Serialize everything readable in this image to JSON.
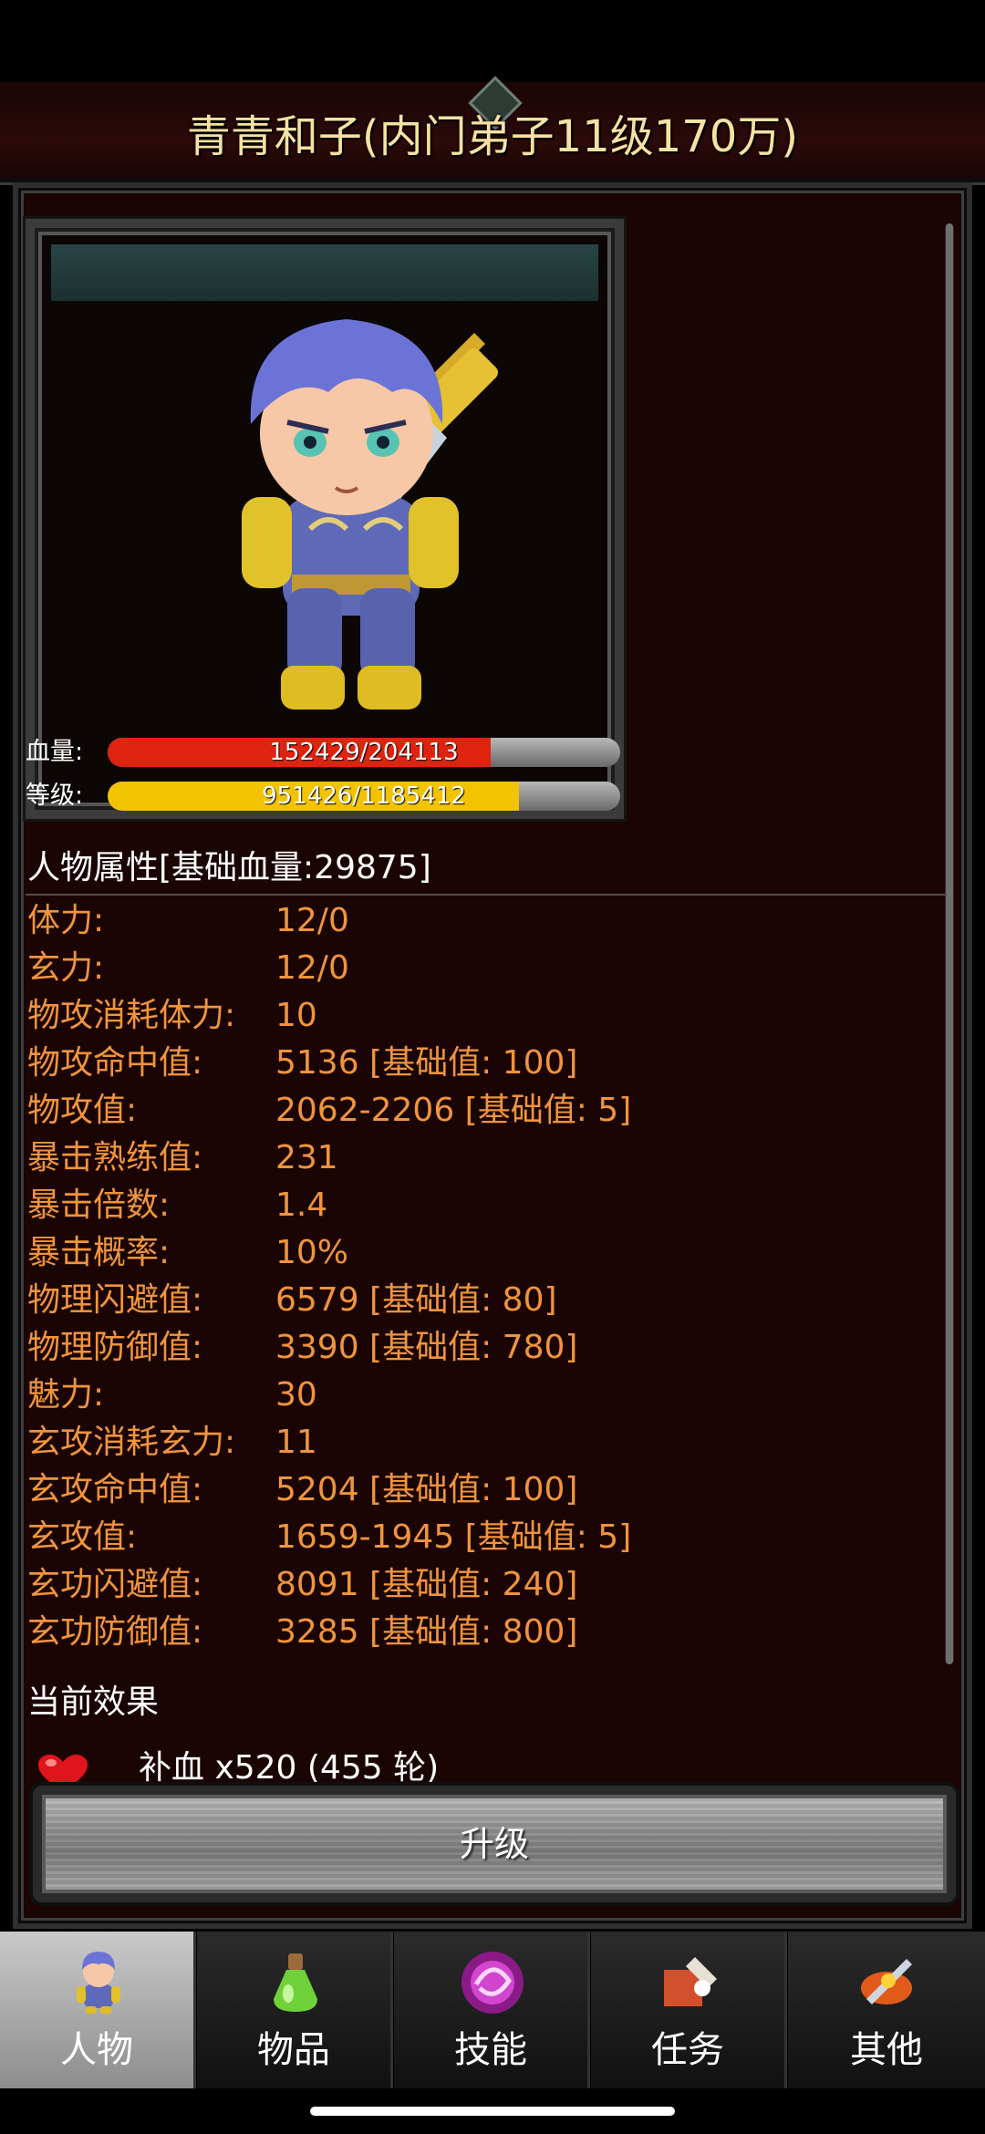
{
  "header": {
    "title": "青青和子(内门弟子11级170万)"
  },
  "character": {
    "hp": {
      "label": "血量:",
      "text": "152429/204113",
      "fraction": 0.7468
    },
    "level": {
      "label": "等级:",
      "text": "951426/1185412",
      "fraction": 0.8026
    }
  },
  "attributes": {
    "heading": "人物属性[基础血量:29875]",
    "rows": [
      {
        "name": "体力:",
        "value": "12/0"
      },
      {
        "name": "玄力:",
        "value": "12/0"
      },
      {
        "name": "物攻消耗体力:",
        "value": "10"
      },
      {
        "name": "物攻命中值:",
        "value": "5136 [基础值: 100]"
      },
      {
        "name": "物攻值:",
        "value": "2062-2206 [基础值: 5]"
      },
      {
        "name": "暴击熟练值:",
        "value": "231"
      },
      {
        "name": "暴击倍数:",
        "value": "1.4"
      },
      {
        "name": "暴击概率:",
        "value": "10%"
      },
      {
        "name": "物理闪避值:",
        "value": "6579 [基础值: 80]"
      },
      {
        "name": "物理防御值:",
        "value": "3390 [基础值: 780]"
      },
      {
        "name": "魅力:",
        "value": "30"
      },
      {
        "name": "玄攻消耗玄力:",
        "value": "11"
      },
      {
        "name": "玄攻命中值:",
        "value": "5204 [基础值: 100]"
      },
      {
        "name": "玄攻值:",
        "value": "1659-1945 [基础值: 5]"
      },
      {
        "name": "玄功闪避值:",
        "value": "8091 [基础值: 240]"
      },
      {
        "name": "玄功防御值:",
        "value": "3285 [基础值: 800]"
      }
    ]
  },
  "effects": {
    "heading": "当前效果",
    "items": [
      {
        "icon": "heart-icon",
        "text": "补血 x520 (455 轮)"
      }
    ]
  },
  "upgrade_button": {
    "label": "升级"
  },
  "nav": {
    "tabs": [
      {
        "label": "人物",
        "icon": "character-icon",
        "active": true
      },
      {
        "label": "物品",
        "icon": "potion-icon",
        "active": false
      },
      {
        "label": "技能",
        "icon": "skill-orb-icon",
        "active": false
      },
      {
        "label": "任务",
        "icon": "quest-icon",
        "active": false
      },
      {
        "label": "其他",
        "icon": "other-icon",
        "active": false
      }
    ]
  },
  "colors": {
    "hp_fill": "#e0230f",
    "exp_fill": "#f2c300",
    "attribute_text": "#f0943d",
    "title_text": "#f7e1a2"
  }
}
